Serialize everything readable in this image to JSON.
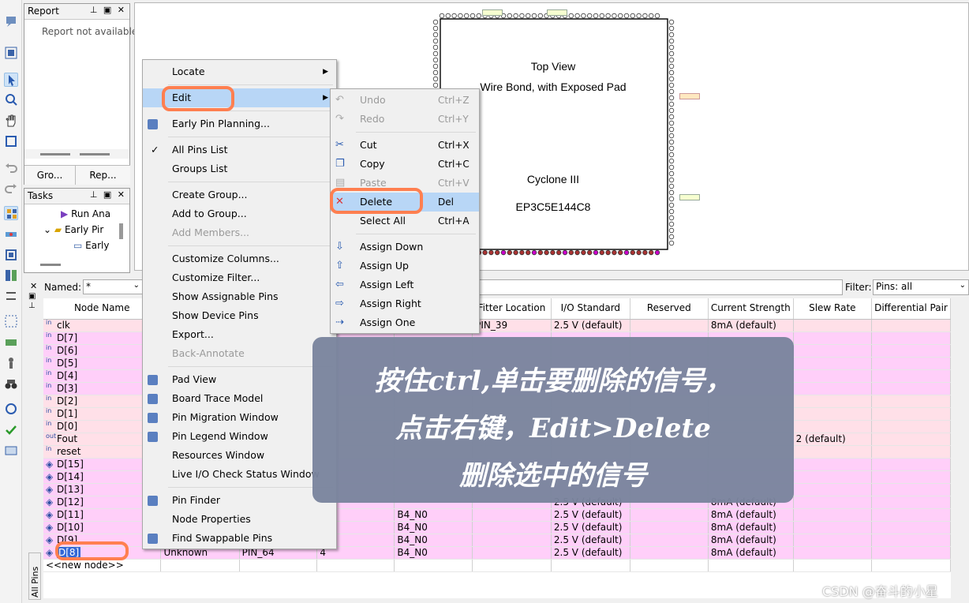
{
  "report_panel": {
    "title": "Report",
    "message": "Report not available",
    "tabs": [
      "Gro...",
      "Rep..."
    ]
  },
  "tasks_panel": {
    "title": "Tasks",
    "items": [
      {
        "label": "Run Ana"
      },
      {
        "label": "Early Pir"
      },
      {
        "label": "Early"
      }
    ]
  },
  "device": {
    "view_title": "Top View",
    "bond": "Wire Bond, with Exposed Pad",
    "family": "Cyclone III",
    "part": "EP3C5E144C8"
  },
  "filter_bar": {
    "named_label": "Named:",
    "named_value": "*",
    "filter_label": "Filter:",
    "filter_value": "Pins: all"
  },
  "table": {
    "columns": [
      "Node Name",
      "",
      "",
      "",
      "",
      "Fitter Location",
      "I/O Standard",
      "Reserved",
      "Current Strength",
      "Slew Rate",
      "Differential Pair"
    ],
    "rows": [
      {
        "dir": "in",
        "name": "clk",
        "c2": "",
        "c3": "",
        "c4": "",
        "c5": "",
        "fitter": "PIN_39",
        "io": "2.5 V (default)",
        "reserved": "",
        "current": "8mA (default)",
        "slew": "",
        "diff": "",
        "style": "in"
      },
      {
        "dir": "in",
        "name": "D[7]",
        "c2": "",
        "c3": "",
        "c4": "",
        "c5": "",
        "fitter": "",
        "io": "",
        "reserved": "",
        "current": "",
        "slew": "",
        "diff": "",
        "style": "bus"
      },
      {
        "dir": "in",
        "name": "D[6]",
        "c2": "",
        "c3": "",
        "c4": "",
        "c5": "",
        "fitter": "",
        "io": "",
        "reserved": "",
        "current": "",
        "slew": "",
        "diff": "",
        "style": "bus"
      },
      {
        "dir": "in",
        "name": "D[5]",
        "c2": "",
        "c3": "",
        "c4": "",
        "c5": "",
        "fitter": "",
        "io": "",
        "reserved": "",
        "current": "",
        "slew": "",
        "diff": "",
        "style": "bus"
      },
      {
        "dir": "in",
        "name": "D[4]",
        "c2": "",
        "c3": "",
        "c4": "",
        "c5": "",
        "fitter": "",
        "io": "",
        "reserved": "",
        "current": "",
        "slew": "",
        "diff": "",
        "style": "bus"
      },
      {
        "dir": "in",
        "name": "D[3]",
        "c2": "",
        "c3": "",
        "c4": "",
        "c5": "",
        "fitter": "",
        "io": "",
        "reserved": "",
        "current": "",
        "slew": "",
        "diff": "",
        "style": "bus"
      },
      {
        "dir": "in",
        "name": "D[2]",
        "c2": "",
        "c3": "",
        "c4": "",
        "c5": "",
        "fitter": "",
        "io": "",
        "reserved": "",
        "current": "",
        "slew": "",
        "diff": "",
        "style": "in"
      },
      {
        "dir": "in",
        "name": "D[1]",
        "c2": "",
        "c3": "",
        "c4": "",
        "c5": "",
        "fitter": "",
        "io": "",
        "reserved": "",
        "current": "",
        "slew": "",
        "diff": "",
        "style": "in"
      },
      {
        "dir": "in",
        "name": "D[0]",
        "c2": "",
        "c3": "",
        "c4": "",
        "c5": "",
        "fitter": "",
        "io": "",
        "reserved": "",
        "current": "",
        "slew": "",
        "diff": "",
        "style": "in"
      },
      {
        "dir": "out",
        "name": "Fout",
        "c2": "",
        "c3": "",
        "c4": "",
        "c5": "",
        "fitter": "",
        "io": "",
        "reserved": "",
        "current": "",
        "slew": "2 (default)",
        "diff": "",
        "style": "in"
      },
      {
        "dir": "in",
        "name": "reset",
        "c2": "",
        "c3": "",
        "c4": "",
        "c5": "",
        "fitter": "",
        "io": "",
        "reserved": "",
        "current": "",
        "slew": "",
        "diff": "",
        "style": "in"
      },
      {
        "dir": "bi",
        "name": "D[15]",
        "c2": "",
        "c3": "",
        "c4": "",
        "c5": "",
        "fitter": "",
        "io": "",
        "reserved": "",
        "current": "",
        "slew": "",
        "diff": "",
        "style": "bus"
      },
      {
        "dir": "bi",
        "name": "D[14]",
        "c2": "",
        "c3": "",
        "c4": "",
        "c5": "",
        "fitter": "",
        "io": "",
        "reserved": "",
        "current": "",
        "slew": "",
        "diff": "",
        "style": "bus"
      },
      {
        "dir": "bi",
        "name": "D[13]",
        "c2": "",
        "c3": "",
        "c4": "",
        "c5": "",
        "fitter": "",
        "io": "",
        "reserved": "",
        "current": "",
        "slew": "",
        "diff": "",
        "style": "bus"
      },
      {
        "dir": "bi",
        "name": "D[12]",
        "c2": "",
        "c3": "",
        "c4": "",
        "c5": "",
        "fitter": "",
        "io": "2.5 V (default)",
        "reserved": "",
        "current": "8mA (default)",
        "slew": "",
        "diff": "",
        "style": "bus"
      },
      {
        "dir": "bi",
        "name": "D[11]",
        "c2": "",
        "c3": "",
        "c4": "",
        "c5": "B4_N0",
        "fitter": "",
        "io": "2.5 V (default)",
        "reserved": "",
        "current": "8mA (default)",
        "slew": "",
        "diff": "",
        "style": "bus"
      },
      {
        "dir": "bi",
        "name": "D[10]",
        "c2": "",
        "c3": "",
        "c4": "",
        "c5": "B4_N0",
        "fitter": "",
        "io": "2.5 V (default)",
        "reserved": "",
        "current": "8mA (default)",
        "slew": "",
        "diff": "",
        "style": "bus"
      },
      {
        "dir": "bi",
        "name": "D[9]",
        "c2": "",
        "c3": "",
        "c4": "",
        "c5": "B4_N0",
        "fitter": "",
        "io": "2.5 V (default)",
        "reserved": "",
        "current": "8mA (default)",
        "slew": "",
        "diff": "",
        "style": "bus"
      },
      {
        "dir": "bi",
        "name": "D[8]",
        "c2": "Unknown",
        "c3": "PIN_64",
        "c4": "4",
        "c5": "B4_N0",
        "fitter": "",
        "io": "2.5 V (default)",
        "reserved": "",
        "current": "8mA (default)",
        "slew": "",
        "diff": "",
        "style": "bus"
      }
    ],
    "new_node": "<<new node>>",
    "side_tab": "All Pins"
  },
  "context_menu": {
    "items": [
      {
        "label": "Locate",
        "submenu": true
      },
      {
        "label": "Edit",
        "submenu": true,
        "highlight": true
      },
      {
        "label": "Early Pin Planning...",
        "icon": "early-pin-planning-icon"
      },
      {
        "label": "All Pins List",
        "checked": true
      },
      {
        "label": "Groups List"
      },
      {
        "label": "Create Group..."
      },
      {
        "label": "Add to Group..."
      },
      {
        "label": "Add Members...",
        "disabled": true
      },
      {
        "label": "Customize Columns..."
      },
      {
        "label": "Customize Filter..."
      },
      {
        "label": "Show Assignable Pins"
      },
      {
        "label": "Show Device Pins"
      },
      {
        "label": "Export..."
      },
      {
        "label": "Back-Annotate",
        "disabled": true
      },
      {
        "label": "Pad View",
        "icon": "pad-view-icon"
      },
      {
        "label": "Board Trace Model",
        "icon": "board-trace-icon"
      },
      {
        "label": "Pin Migration Window",
        "icon": "pin-migration-icon"
      },
      {
        "label": "Pin Legend Window",
        "icon": "pin-legend-icon"
      },
      {
        "label": "Resources Window"
      },
      {
        "label": "Live I/O Check Status Window"
      },
      {
        "label": "Pin Finder",
        "icon": "binoculars-icon"
      },
      {
        "label": "Node Properties"
      },
      {
        "label": "Find Swappable Pins",
        "icon": "swap-icon"
      }
    ]
  },
  "edit_submenu": {
    "items": [
      {
        "label": "Undo",
        "shortcut": "Ctrl+Z",
        "disabled": true
      },
      {
        "label": "Redo",
        "shortcut": "Ctrl+Y",
        "disabled": true
      },
      {
        "label": "Cut",
        "shortcut": "Ctrl+X"
      },
      {
        "label": "Copy",
        "shortcut": "Ctrl+C"
      },
      {
        "label": "Paste",
        "shortcut": "Ctrl+V",
        "disabled": true
      },
      {
        "label": "Delete",
        "shortcut": "Del",
        "highlight": true
      },
      {
        "label": "Select All",
        "shortcut": "Ctrl+A"
      },
      {
        "label": "Assign Down",
        "shortcut": ""
      },
      {
        "label": "Assign Up",
        "shortcut": ""
      },
      {
        "label": "Assign Left",
        "shortcut": ""
      },
      {
        "label": "Assign Right",
        "shortcut": ""
      },
      {
        "label": "Assign One",
        "shortcut": ""
      }
    ]
  },
  "note": {
    "line1": "按住ctrl,单击要删除的信号，",
    "line2": "点击右键，Edit>Delete",
    "line3": "删除选中的信号"
  },
  "watermark": "CSDN @奋斗的小星",
  "colors": {
    "highlight": "#b8d6f6",
    "annotation": "#ff7f50",
    "note_bg": "#7a849d",
    "row_bus": "#ffcff9",
    "row_in": "#ffe0e8"
  }
}
